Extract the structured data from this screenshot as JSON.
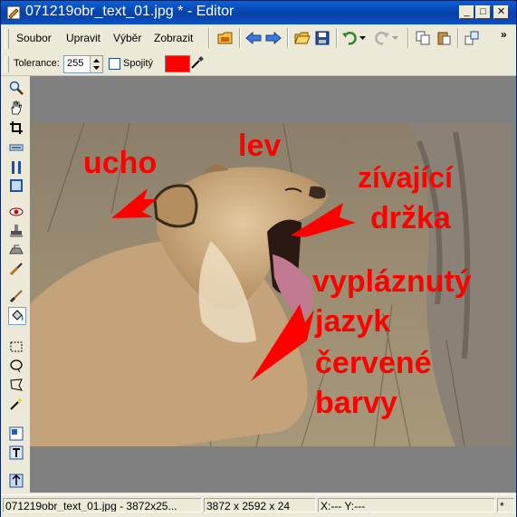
{
  "window": {
    "title": "071219obr_text_01.jpg * - Editor",
    "minimize_glyph": "_",
    "maximize_glyph": "□",
    "close_glyph": "✕"
  },
  "menu": {
    "items": [
      "Soubor",
      "Upravit",
      "Výběr",
      "Zobrazit"
    ],
    "overflow": "»"
  },
  "options": {
    "tolerance_label": "Tolerance:",
    "tolerance_value": "255",
    "contiguous_label": "Spojitý",
    "fill_color": "#ff0000"
  },
  "image_annotations": {
    "ucho": "ucho",
    "lev": "lev",
    "zivajici": "zívající",
    "drzka": "držka",
    "vyplaznuty": "vypláznutý",
    "jazyk": "jazyk",
    "cervene": "červené",
    "barvy": "barvy"
  },
  "status": {
    "file": "071219obr_text_01.jpg - 3872x25...",
    "dimensions": "3872 x 2592 x 24",
    "coords": "X:---   Y:---",
    "modified": "*"
  },
  "colors": {
    "annotation": "#ff0000",
    "titlebar": "#0a52c6"
  }
}
